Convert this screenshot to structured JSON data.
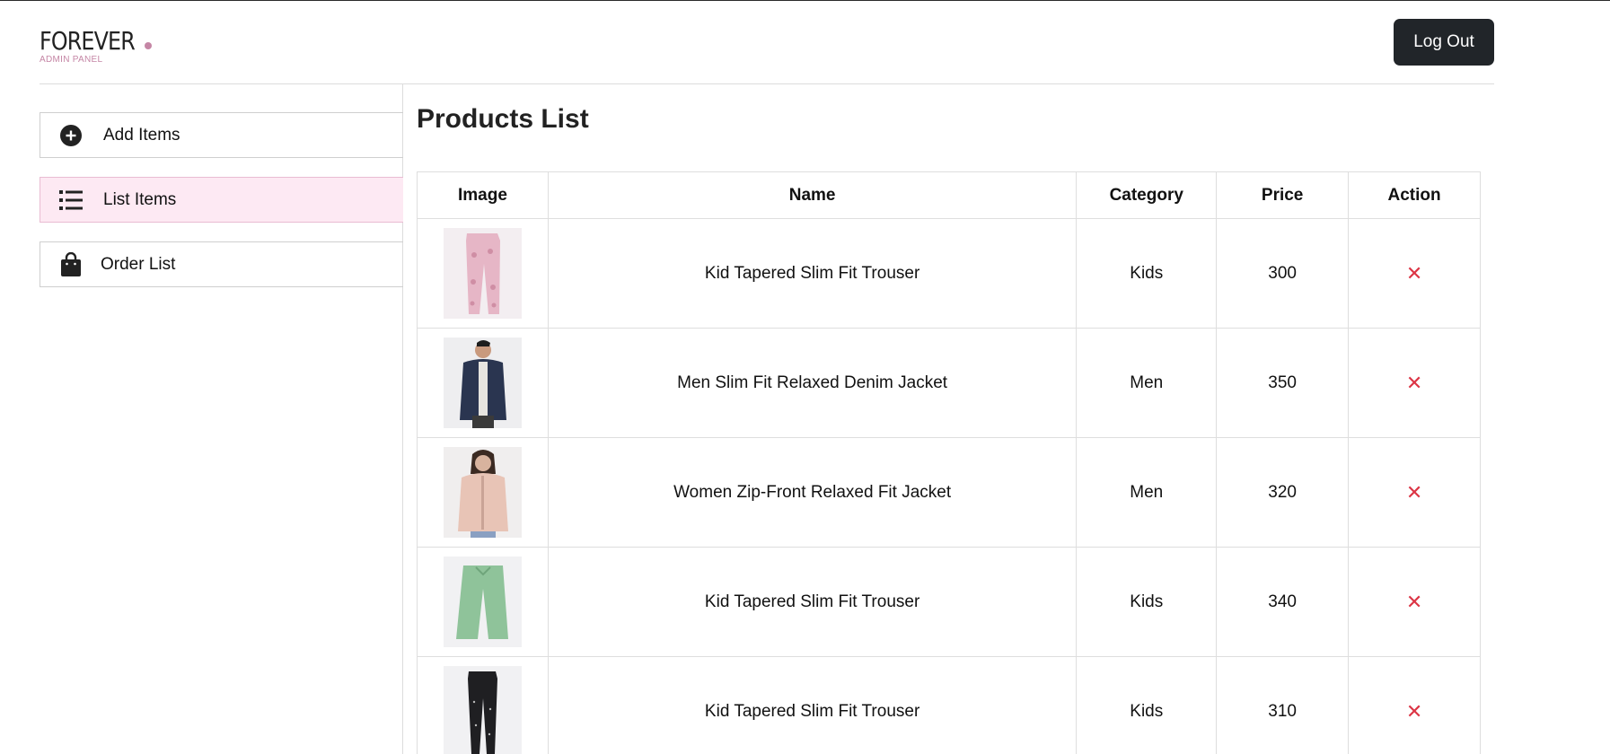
{
  "header": {
    "logo_text": "FOREVER",
    "logo_subtitle": "ADMIN PANEL",
    "logout_label": "Log Out"
  },
  "sidebar": {
    "items": [
      {
        "label": "Add Items",
        "icon": "plus-circle-icon",
        "active": false
      },
      {
        "label": "List Items",
        "icon": "list-icon",
        "active": true
      },
      {
        "label": "Order List",
        "icon": "shopping-bag-icon",
        "active": false
      }
    ]
  },
  "main": {
    "title": "Products List",
    "columns": [
      "Image",
      "Name",
      "Category",
      "Price",
      "Action"
    ],
    "rows": [
      {
        "image": "pink-printed-trouser",
        "name": "Kid Tapered Slim Fit Trouser",
        "category": "Kids",
        "price": "300",
        "action": "✕"
      },
      {
        "image": "denim-jacket",
        "name": "Men Slim Fit Relaxed Denim Jacket",
        "category": "Men",
        "price": "350",
        "action": "✕"
      },
      {
        "image": "pink-bomber-jacket",
        "name": "Women Zip-Front Relaxed Fit Jacket",
        "category": "Men",
        "price": "320",
        "action": "✕"
      },
      {
        "image": "green-trouser",
        "name": "Kid Tapered Slim Fit Trouser",
        "category": "Kids",
        "price": "340",
        "action": "✕"
      },
      {
        "image": "black-dotted-trouser",
        "name": "Kid Tapered Slim Fit Trouser",
        "category": "Kids",
        "price": "310",
        "action": "✕"
      }
    ]
  },
  "colors": {
    "accent_pink": "#c586a5",
    "active_bg": "#fde9f3",
    "button_dark": "#212529",
    "delete_red": "#dc3545"
  }
}
